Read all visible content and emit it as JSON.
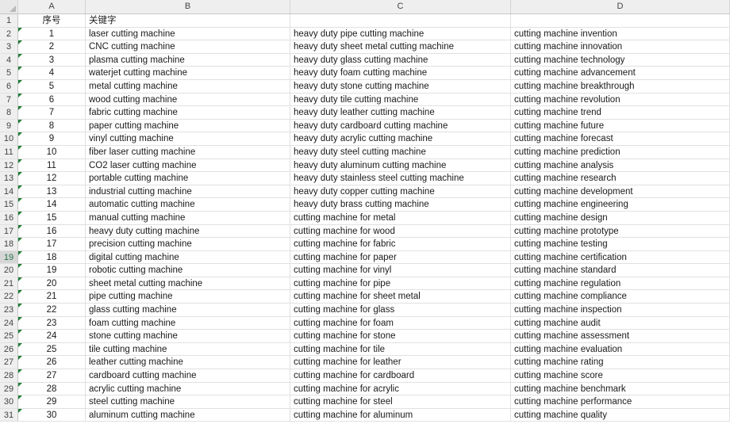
{
  "columns": [
    "A",
    "B",
    "C",
    "D"
  ],
  "rows": [
    {
      "n": "1",
      "a": "序号",
      "b": "关键字",
      "c": "",
      "d": ""
    },
    {
      "n": "2",
      "a": "1",
      "b": "laser cutting machine",
      "c": "heavy duty pipe cutting machine",
      "d": "cutting machine invention"
    },
    {
      "n": "3",
      "a": "2",
      "b": "CNC cutting machine",
      "c": "heavy duty sheet metal cutting machine",
      "d": "cutting machine innovation"
    },
    {
      "n": "4",
      "a": "3",
      "b": "plasma cutting machine",
      "c": "heavy duty glass cutting machine",
      "d": "cutting machine technology"
    },
    {
      "n": "5",
      "a": "4",
      "b": "waterjet cutting machine",
      "c": "heavy duty foam cutting machine",
      "d": "cutting machine advancement"
    },
    {
      "n": "6",
      "a": "5",
      "b": "metal cutting machine",
      "c": "heavy duty stone cutting machine",
      "d": "cutting machine breakthrough"
    },
    {
      "n": "7",
      "a": "6",
      "b": "wood cutting machine",
      "c": "heavy duty tile cutting machine",
      "d": "cutting machine revolution"
    },
    {
      "n": "8",
      "a": "7",
      "b": "fabric cutting machine",
      "c": "heavy duty leather cutting machine",
      "d": "cutting machine trend"
    },
    {
      "n": "9",
      "a": "8",
      "b": "paper cutting machine",
      "c": "heavy duty cardboard cutting machine",
      "d": "cutting machine future"
    },
    {
      "n": "10",
      "a": "9",
      "b": "vinyl cutting machine",
      "c": "heavy duty acrylic cutting machine",
      "d": "cutting machine forecast"
    },
    {
      "n": "11",
      "a": "10",
      "b": "fiber laser cutting machine",
      "c": "heavy duty steel cutting machine",
      "d": "cutting machine prediction"
    },
    {
      "n": "12",
      "a": "11",
      "b": "CO2 laser cutting machine",
      "c": "heavy duty aluminum cutting machine",
      "d": "cutting machine analysis"
    },
    {
      "n": "13",
      "a": "12",
      "b": "portable cutting machine",
      "c": "heavy duty stainless steel cutting machine",
      "d": "cutting machine research"
    },
    {
      "n": "14",
      "a": "13",
      "b": "industrial cutting machine",
      "c": "heavy duty copper cutting machine",
      "d": "cutting machine development"
    },
    {
      "n": "15",
      "a": "14",
      "b": "automatic cutting machine",
      "c": "heavy duty brass cutting machine",
      "d": "cutting machine engineering"
    },
    {
      "n": "16",
      "a": "15",
      "b": "manual cutting machine",
      "c": "cutting machine for metal",
      "d": "cutting machine design"
    },
    {
      "n": "17",
      "a": "16",
      "b": "heavy duty cutting machine",
      "c": "cutting machine for wood",
      "d": "cutting machine prototype"
    },
    {
      "n": "18",
      "a": "17",
      "b": "precision cutting machine",
      "c": "cutting machine for fabric",
      "d": "cutting machine testing"
    },
    {
      "n": "19",
      "a": "18",
      "b": "digital cutting machine",
      "c": "cutting machine for paper",
      "d": "cutting machine certification"
    },
    {
      "n": "20",
      "a": "19",
      "b": "robotic cutting machine",
      "c": "cutting machine for vinyl",
      "d": "cutting machine standard"
    },
    {
      "n": "21",
      "a": "20",
      "b": "sheet metal cutting machine",
      "c": "cutting machine for pipe",
      "d": "cutting machine regulation"
    },
    {
      "n": "22",
      "a": "21",
      "b": "pipe cutting machine",
      "c": "cutting machine for sheet metal",
      "d": "cutting machine compliance"
    },
    {
      "n": "23",
      "a": "22",
      "b": "glass cutting machine",
      "c": "cutting machine for glass",
      "d": "cutting machine inspection"
    },
    {
      "n": "24",
      "a": "23",
      "b": "foam cutting machine",
      "c": "cutting machine for foam",
      "d": "cutting machine audit"
    },
    {
      "n": "25",
      "a": "24",
      "b": "stone cutting machine",
      "c": "cutting machine for stone",
      "d": "cutting machine assessment"
    },
    {
      "n": "26",
      "a": "25",
      "b": "tile cutting machine",
      "c": "cutting machine for tile",
      "d": "cutting machine evaluation"
    },
    {
      "n": "27",
      "a": "26",
      "b": "leather cutting machine",
      "c": "cutting machine for leather",
      "d": "cutting machine rating"
    },
    {
      "n": "28",
      "a": "27",
      "b": "cardboard cutting machine",
      "c": "cutting machine for cardboard",
      "d": "cutting machine score"
    },
    {
      "n": "29",
      "a": "28",
      "b": "acrylic cutting machine",
      "c": "cutting machine for acrylic",
      "d": "cutting machine benchmark"
    },
    {
      "n": "30",
      "a": "29",
      "b": "steel cutting machine",
      "c": "cutting machine for steel",
      "d": "cutting machine performance"
    },
    {
      "n": "31",
      "a": "30",
      "b": "aluminum cutting machine",
      "c": "cutting machine for aluminum",
      "d": "cutting machine quality"
    }
  ],
  "selected_row": "19",
  "colors": {
    "flag": "#1e7b34",
    "selected_header": "#d6d6d6",
    "header": "#efefef"
  }
}
